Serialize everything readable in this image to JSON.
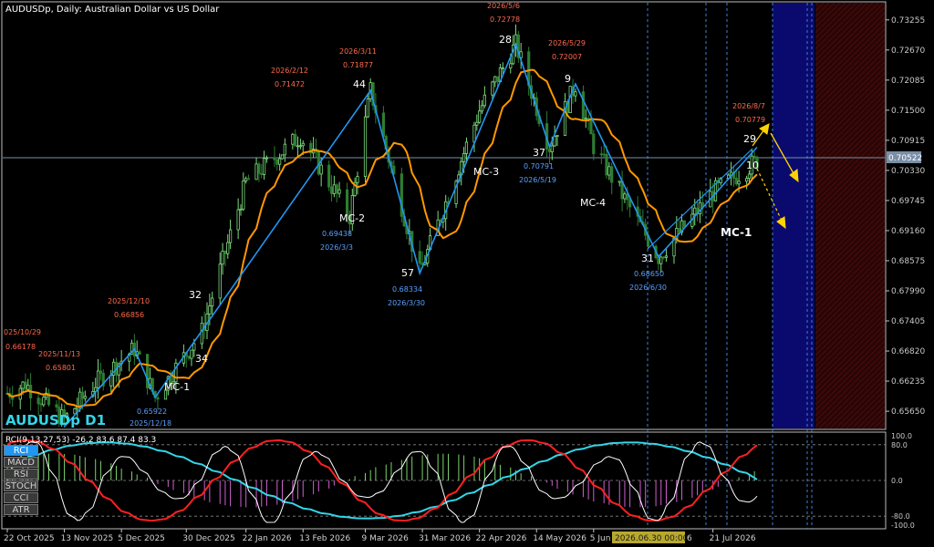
{
  "header": {
    "title": "AUDUSDp, Daily:  Australian Dollar vs US Dollar",
    "symbol_label": "AUDUSDp D1"
  },
  "colors": {
    "background": "#000000",
    "axis": "#c8c8c8",
    "bull_candle": "#7fdc7f",
    "bear_candle": "#2e7d32",
    "ma_line": "#ff9800",
    "zigzag": "#2196f3",
    "label_red": "#ff6a4a",
    "label_blue": "#5aa0ff",
    "forecast_arrow": "#ffd400",
    "zone_blue": "#0a0a6e",
    "zone_red": "#3a0808",
    "rci_fast": "#ffffff",
    "rci_mid": "#ff2020",
    "rci_slow": "#33d6e8",
    "hist_pos": "#7bd36c",
    "hist_neg": "#d060d0"
  },
  "price_axis": {
    "ticks": [
      "0.73255",
      "0.72670",
      "0.72085",
      "0.71500",
      "0.70915",
      "0.70330",
      "0.69745",
      "0.69160",
      "0.68575",
      "0.67990",
      "0.67405",
      "0.66820",
      "0.66235",
      "0.65650"
    ],
    "current_price": "0.70522"
  },
  "time_axis": {
    "labels": [
      "22 Oct 2025",
      "13 Nov 2025",
      "5 Dec 2025",
      "30 Dec 2025",
      "22 Jan 2026",
      "13 Feb 2026",
      "9 Mar 2026",
      "31 Mar 2026",
      "22 Apr 2026",
      "14 May 2026",
      "5 Jun 2026",
      "21 Jul 2026"
    ],
    "cursor_label": "2026.06.30 00:00",
    "cursor_suffix": "6"
  },
  "annotations": {
    "numbers": [
      {
        "text": "32",
        "color": "white"
      },
      {
        "text": "34",
        "color": "white"
      },
      {
        "text": "44",
        "color": "white"
      },
      {
        "text": "57",
        "color": "white"
      },
      {
        "text": "28",
        "color": "white"
      },
      {
        "text": "37",
        "color": "white"
      },
      {
        "text": "9",
        "color": "white"
      },
      {
        "text": "31",
        "color": "white"
      },
      {
        "text": "29",
        "color": "white"
      },
      {
        "text": "10",
        "color": "white"
      }
    ],
    "mc_labels": [
      "MC-1",
      "MC-2",
      "MC-3",
      "MC-4",
      "MC-1"
    ],
    "red_labels": [
      {
        "date": "025/10/29",
        "price": "0.66178"
      },
      {
        "date": "2025/11/13",
        "price": "0.65801"
      },
      {
        "date": "2025/12/10",
        "price": "0.66856"
      },
      {
        "date": "2026/2/12",
        "price": "0.71472"
      },
      {
        "date": "2026/3/11",
        "price": "0.71877"
      },
      {
        "date": "2026/5/6",
        "price": "0.72778"
      },
      {
        "date": "2026/5/29",
        "price": "0.72007"
      },
      {
        "date": "2026/8/7",
        "price": "0.70779"
      }
    ],
    "blue_labels": [
      {
        "price": "0.65922",
        "date": "2025/12/18"
      },
      {
        "price": "0.69438",
        "date": "2026/3/3"
      },
      {
        "price": "0.68334",
        "date": "2026/3/30"
      },
      {
        "price": "0.70791",
        "date": "2026/5/19"
      },
      {
        "price": "0.68650",
        "date": "2026/6/30"
      }
    ]
  },
  "indicator": {
    "title": "RCI(9,13,27,53) -26.2 83.6 87.4 83.3",
    "levels": [
      "100.0",
      "80.0",
      "0.0",
      "-80.0",
      "-100.0"
    ],
    "buttons": [
      {
        "label": "RCI",
        "active": true
      },
      {
        "label": "MACD",
        "active": false
      },
      {
        "label": "RSI",
        "active": false
      },
      {
        "label": "STOCH",
        "active": false
      },
      {
        "label": "CCI",
        "active": false
      },
      {
        "label": "ATR",
        "active": false
      }
    ]
  },
  "chart_data": {
    "type": "candlestick",
    "title": "AUDUSDp, Daily:  Australian Dollar vs US Dollar",
    "ylim": [
      0.6535,
      0.735
    ],
    "approximate_close_path": [
      {
        "x": "2025-10-22",
        "y": 0.66
      },
      {
        "x": "2025-10-29",
        "y": 0.6618
      },
      {
        "x": "2025-11-13",
        "y": 0.6548
      },
      {
        "x": "2025-11-25",
        "y": 0.662
      },
      {
        "x": "2025-12-10",
        "y": 0.6686
      },
      {
        "x": "2025-12-18",
        "y": 0.6592
      },
      {
        "x": "2026-01-05",
        "y": 0.672
      },
      {
        "x": "2026-01-22",
        "y": 0.701
      },
      {
        "x": "2026-02-12",
        "y": 0.71
      },
      {
        "x": "2026-03-03",
        "y": 0.6944
      },
      {
        "x": "2026-03-11",
        "y": 0.7188
      },
      {
        "x": "2026-03-30",
        "y": 0.6833
      },
      {
        "x": "2026-04-22",
        "y": 0.715
      },
      {
        "x": "2026-05-06",
        "y": 0.7278
      },
      {
        "x": "2026-05-19",
        "y": 0.7079
      },
      {
        "x": "2026-05-29",
        "y": 0.7201
      },
      {
        "x": "2026-06-05",
        "y": 0.708
      },
      {
        "x": "2026-06-30",
        "y": 0.6865
      },
      {
        "x": "2026-07-21",
        "y": 0.699
      },
      {
        "x": "2026-08-07",
        "y": 0.7052
      }
    ],
    "zigzag_points": [
      {
        "x": "2025-11-13",
        "y": 0.6535
      },
      {
        "x": "2025-12-10",
        "y": 0.6686
      },
      {
        "x": "2025-12-18",
        "y": 0.6592
      },
      {
        "x": "2026-03-11",
        "y": 0.7188
      },
      {
        "x": "2026-03-30",
        "y": 0.6833
      },
      {
        "x": "2026-05-06",
        "y": 0.7278
      },
      {
        "x": "2026-05-19",
        "y": 0.7079
      },
      {
        "x": "2026-05-29",
        "y": 0.7201
      },
      {
        "x": "2026-06-30",
        "y": 0.6865
      },
      {
        "x": "2026-08-07",
        "y": 0.7078
      }
    ],
    "current_price": 0.70522,
    "indicator_ylim": [
      -100,
      100
    ],
    "rci_last_values": [
      -26.2,
      83.6,
      87.4,
      83.3
    ]
  }
}
